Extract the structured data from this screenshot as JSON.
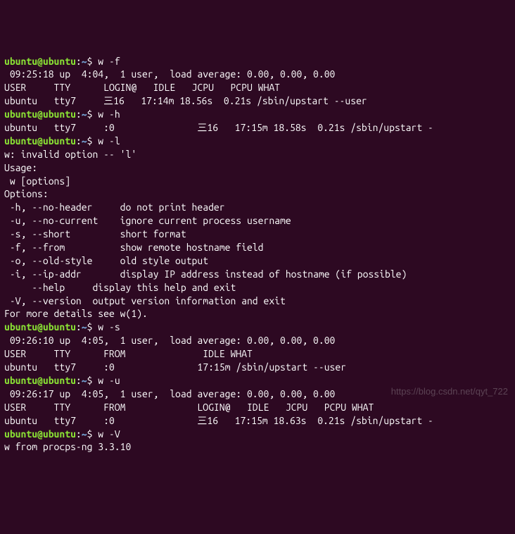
{
  "prompt": {
    "user_host": "ubuntu@ubuntu",
    "sep": ":",
    "path": "~",
    "dollar": "$ "
  },
  "blocks": [
    {
      "cmd": "w -f",
      "output": [
        " 09:25:18 up  4:04,  1 user,  load average: 0.00, 0.00, 0.00",
        "USER     TTY      LOGIN@   IDLE   JCPU   PCPU WHAT",
        "ubuntu   tty7     三16   17:14m 18.56s  0.21s /sbin/upstart --user"
      ]
    },
    {
      "cmd": "w -h",
      "output": [
        "ubuntu   tty7     :0               三16   17:15m 18.58s  0.21s /sbin/upstart -"
      ]
    },
    {
      "cmd": "w -l",
      "output": [
        "w: invalid option -- 'l'",
        "",
        "Usage:",
        " w [options]",
        "",
        "Options:",
        " -h, --no-header     do not print header",
        " -u, --no-current    ignore current process username",
        " -s, --short         short format",
        " -f, --from          show remote hostname field",
        " -o, --old-style     old style output",
        " -i, --ip-addr       display IP address instead of hostname (if possible)",
        "",
        "     --help     display this help and exit",
        " -V, --version  output version information and exit",
        "",
        "For more details see w(1)."
      ]
    },
    {
      "cmd": "w -s",
      "output": [
        " 09:26:10 up  4:05,  1 user,  load average: 0.00, 0.00, 0.00",
        "USER     TTY      FROM              IDLE WHAT",
        "ubuntu   tty7     :0               17:15m /sbin/upstart --user"
      ]
    },
    {
      "cmd": "w -u",
      "output": [
        " 09:26:17 up  4:05,  1 user,  load average: 0.00, 0.00, 0.00",
        "USER     TTY      FROM             LOGIN@   IDLE   JCPU   PCPU WHAT",
        "ubuntu   tty7     :0               三16   17:15m 18.63s  0.21s /sbin/upstart -"
      ]
    },
    {
      "cmd": "w -V",
      "output": [
        "w from procps-ng 3.3.10"
      ]
    }
  ],
  "watermark": "https://blog.csdn.net/qyt_722"
}
